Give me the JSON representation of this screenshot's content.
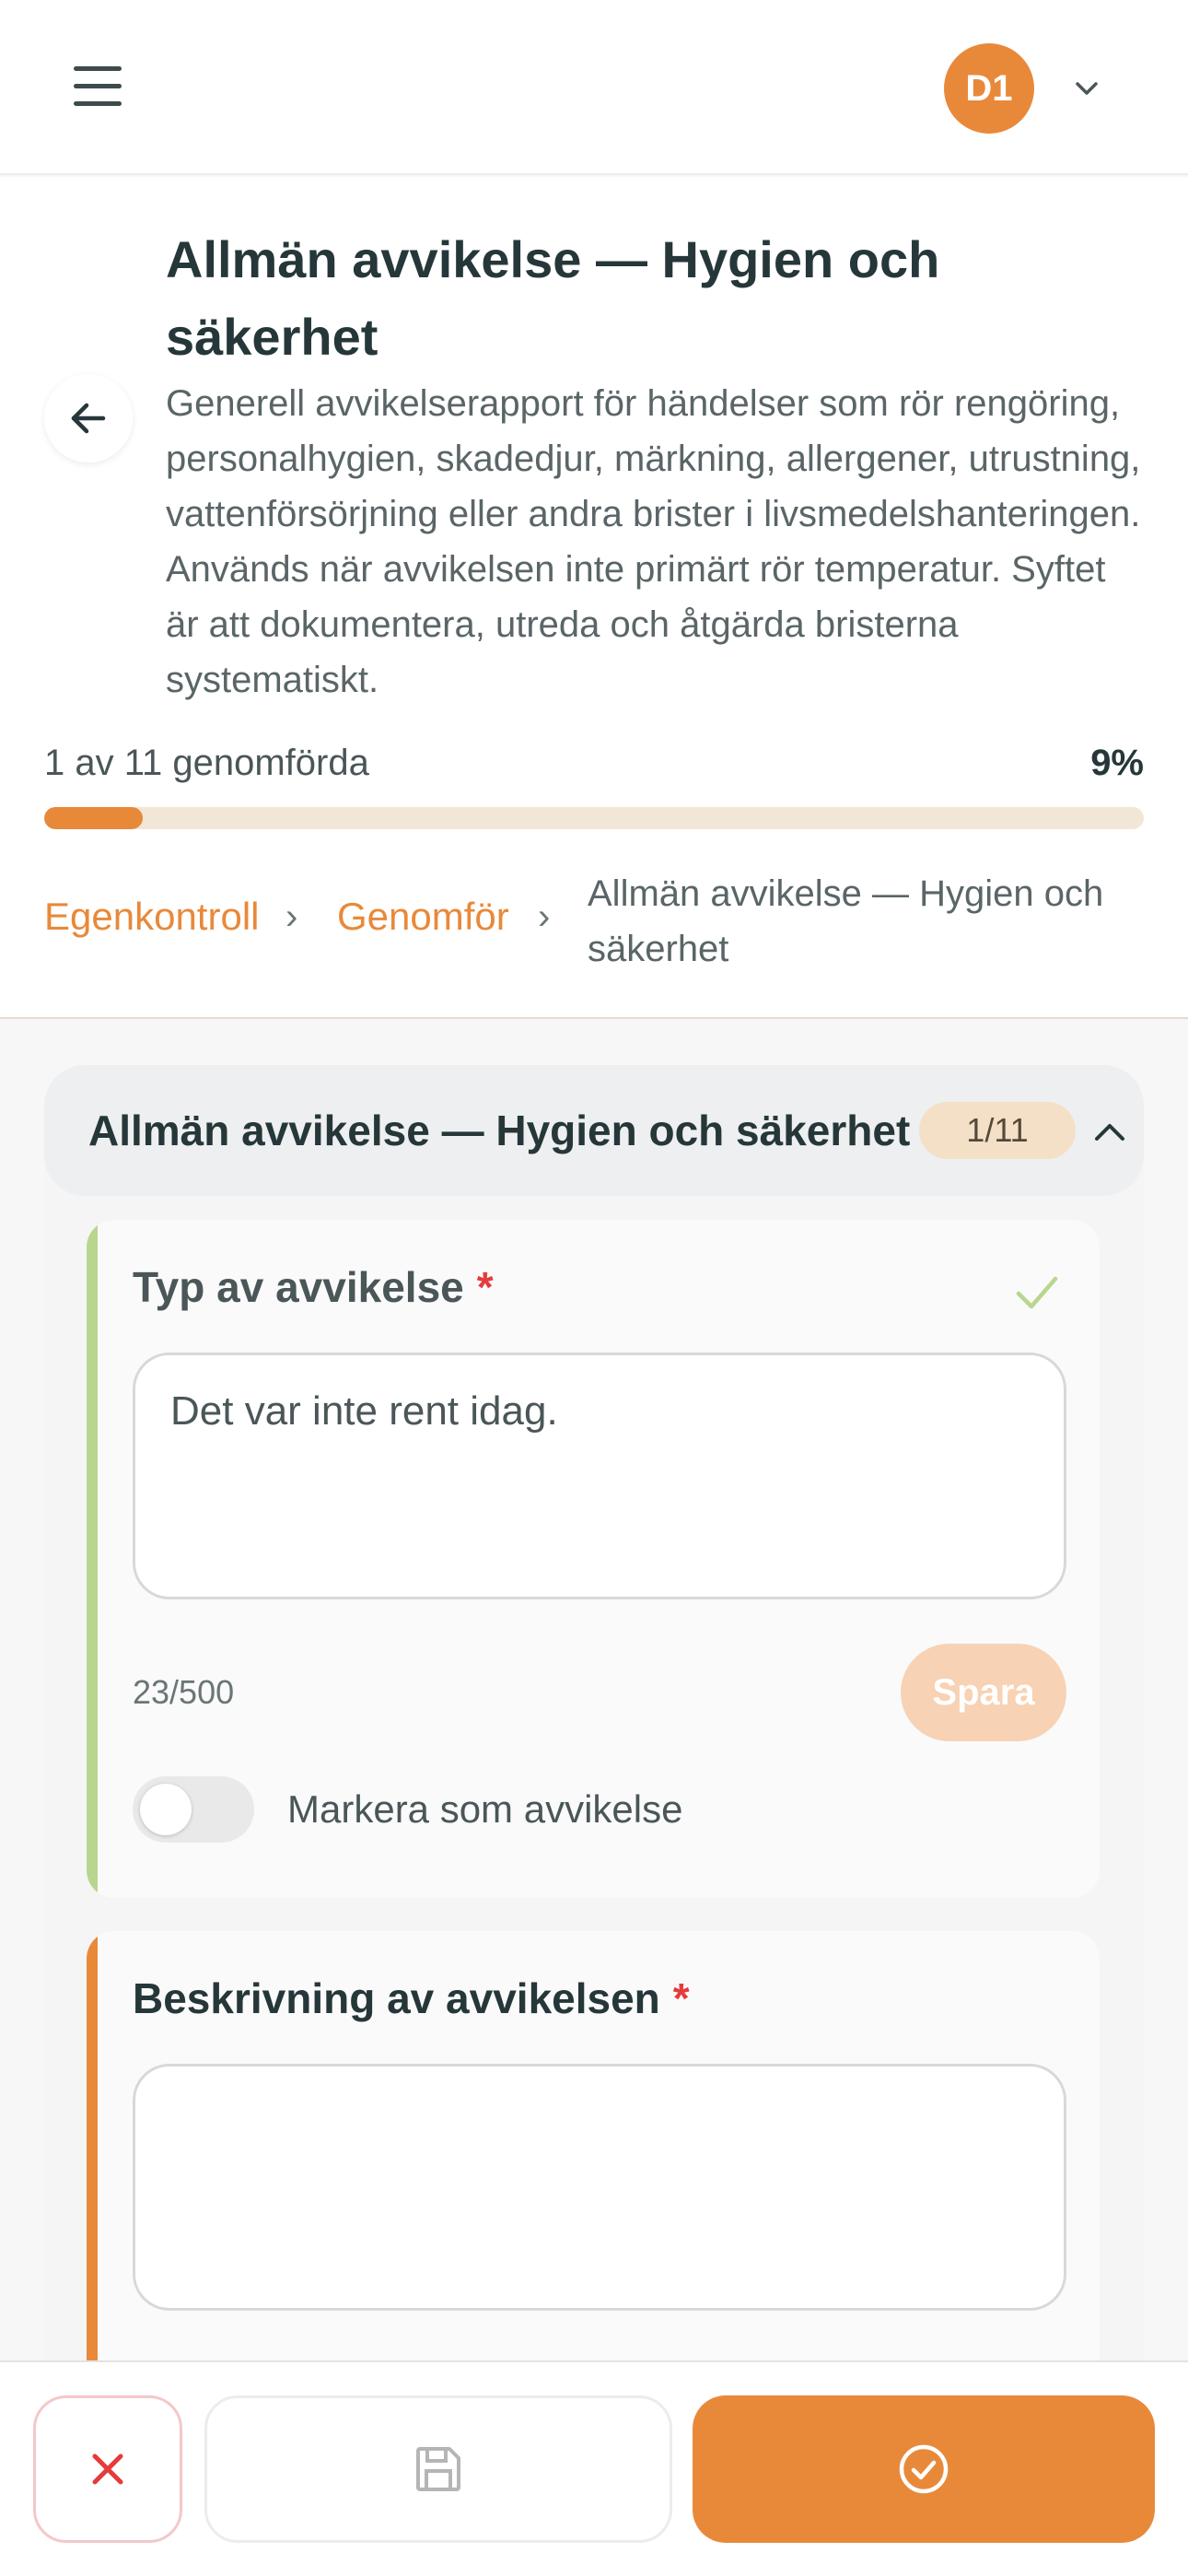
{
  "topbar": {
    "menu_icon": "hamburger-icon",
    "avatar_initials": "D1",
    "avatar_color": "#e8893a",
    "avatar_dropdown_icon": "chevron-down-icon"
  },
  "header": {
    "title": "Allmän avvikelse — Hygien och säkerhet",
    "description": "Generell avvikelserapport för händelser som rör rengöring, personalhygien, skadedjur, märkning, allergener, utrustning, vattenförsörjning eller andra brister i livsmedelshanteringen. Används när avvikelsen inte primärt rör temperatur. Syftet är att dokumentera, utreda och åtgärda bristerna systematiskt.",
    "back_icon": "arrow-left-icon",
    "progress": {
      "label": "1 av 11 genomförda",
      "percent_text": "9%",
      "fraction": 0.09
    },
    "breadcrumb": {
      "items": [
        "Egenkontroll",
        "Genomför"
      ],
      "separator": "›",
      "current": "Allmän avvikelse — Hygien och säkerhet"
    }
  },
  "section": {
    "title": "Allmän avvikelse — Hygien och säkerhet",
    "badge": "1/11",
    "collapse_icon": "chevron-up-icon"
  },
  "questions": [
    {
      "label": "Typ av avvikelse",
      "required_mark": "*",
      "answer": "Det var inte rent idag.",
      "char_count": "23/500",
      "save_label": "Spara",
      "toggle_label": "Markera som avvikelse",
      "toggle_on": false,
      "status_icon": "check-icon",
      "accent_color": "#b9d68e"
    },
    {
      "label": "Beskrivning av avvikelsen",
      "required_mark": "*",
      "answer": "",
      "accent_color": "#e8893a"
    }
  ],
  "bottom_bar": {
    "cancel_icon": "close-icon",
    "save_draft_icon": "floppy-disk-icon",
    "complete_icon": "check-circle-icon",
    "accent": "#e8893a"
  }
}
